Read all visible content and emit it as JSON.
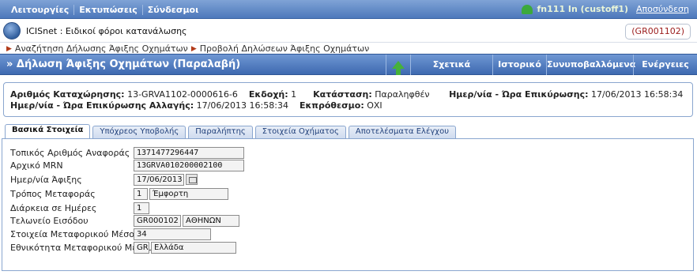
{
  "topbar": {
    "menu": [
      "Λειτουργίες",
      "Εκτυπώσεις",
      "Σύνδεσμοι"
    ],
    "user_label": "fn111 In (custoff1)",
    "logout": "Αποσύνδεση"
  },
  "app": {
    "title": "ICISnet : Ειδικοί φόροι κατανάλωσης",
    "office_code": "(GR001102)"
  },
  "breadcrumb": [
    "Αναζήτηση Δήλωσης Άφιξης Οχημάτων",
    "Προβολή Δηλώσεων Άφιξης Οχημάτων"
  ],
  "titlebar": {
    "title": "» Δήλωση Άφιξης Οχημάτων (Παραλαβή)",
    "buttons": [
      "Σχετικά Μηνύματα",
      "Ιστορικό",
      "Συνυποβαλλόμενα",
      "Ενέργειες"
    ]
  },
  "info": {
    "reg_no_label": "Αριθμός Καταχώρησης:",
    "reg_no": "13-GRVA1102-0000616-6",
    "version_label": "Εκδοχή:",
    "version": "1",
    "status_label": "Κατάσταση:",
    "status": "Παραληφθέν",
    "confirm_dt_label": "Ημερ/νία - Ώρα Επικύρωσης:",
    "confirm_dt": "17/06/2013 16:58:34",
    "change_dt_label": "Ημερ/νία - Ώρα Επικύρωσης Αλλαγής:",
    "change_dt": "17/06/2013 16:58:34",
    "overdue_label": "Εκπρόθεσμο:",
    "overdue": "ΟΧΙ"
  },
  "tabs": [
    "Βασικά Στοιχεία",
    "Υπόχρεος Υποβολής",
    "Παραλήπτης",
    "Στοιχεία Οχήματος",
    "Αποτελέσματα Ελέγχου"
  ],
  "form": {
    "local_ref_label": "Τοπικός Αριθμός Αναφοράς",
    "local_ref": "1371477296447",
    "mrn_label": "Αρχικό MRN",
    "mrn": "13GRVA010200002100",
    "arrival_date_label": "Ημερ/νία Άφιξης",
    "arrival_date": "17/06/2013",
    "transport_mode_label": "Τρόπος Μεταφοράς",
    "transport_mode_code": "1",
    "transport_mode_desc": "Έμφορτη",
    "duration_label": "Διάρκεια σε Ημέρες",
    "duration": "1",
    "customs_office_label": "Τελωνείο Εισόδου",
    "customs_office_code": "GR000102",
    "customs_office_name": "ΑΘΗΝΩΝ",
    "transport_means_label": "Στοιχεία Μεταφορικού Μέσου",
    "transport_means": "34",
    "nationality_label": "Εθνικότητα Μεταφορικού Μέσου",
    "nationality_code": "GR",
    "nationality_name": "Ελλάδα"
  }
}
